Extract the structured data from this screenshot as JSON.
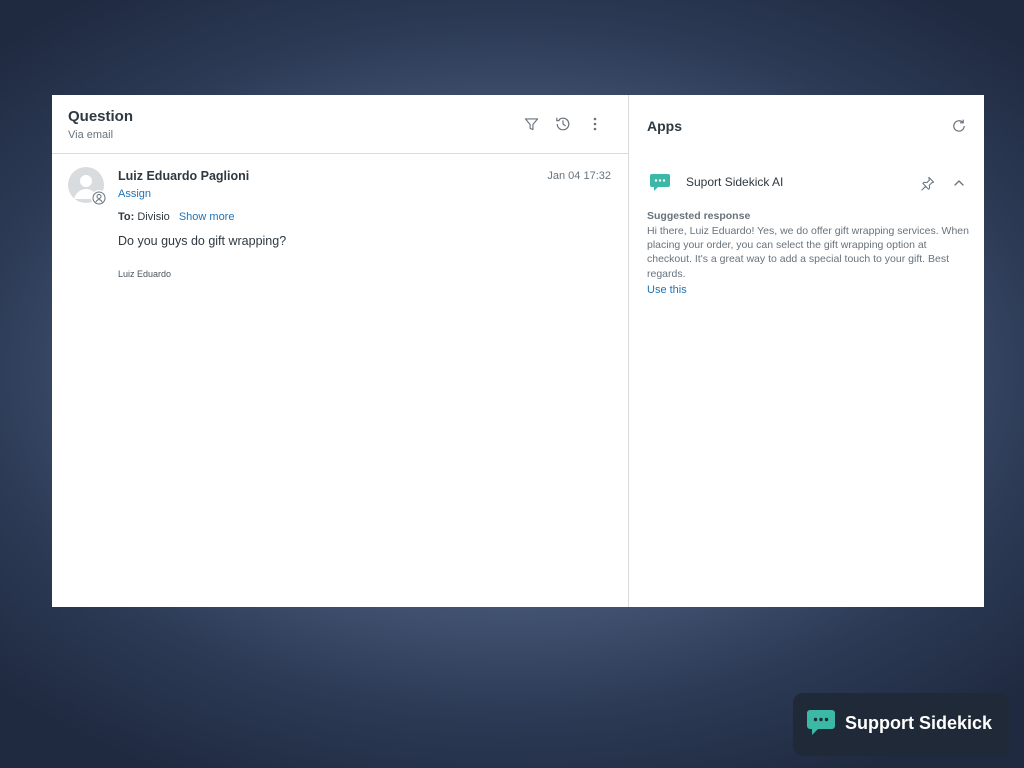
{
  "ticket": {
    "title": "Question",
    "channel": "Via email",
    "header_icons": [
      "filter-icon",
      "history-icon",
      "more-options-icon"
    ]
  },
  "message": {
    "sender": "Luiz Eduardo Paglioni",
    "timestamp": "Jan 04 17:32",
    "assign_label": "Assign",
    "to_label": "To:",
    "to_value": "Divisio",
    "show_more_label": "Show more",
    "body": "Do you guys do gift wrapping?",
    "signature": "Luiz Eduardo"
  },
  "apps": {
    "title": "Apps",
    "app_name": "Suport Sidekick AI",
    "suggested_label": "Suggested response",
    "suggested_text": "Hi there, Luiz Eduardo! Yes, we do offer gift wrapping services. When placing your order, you can select the gift wrapping option at checkout. It's a great way to add a special touch to your gift. Best regards.",
    "use_this_label": "Use this"
  },
  "brand": {
    "name": "Support Sidekick"
  },
  "colors": {
    "accent_link": "#1f73b7",
    "app_teal": "#3bb8a6",
    "brand_bg": "#1f2937"
  }
}
